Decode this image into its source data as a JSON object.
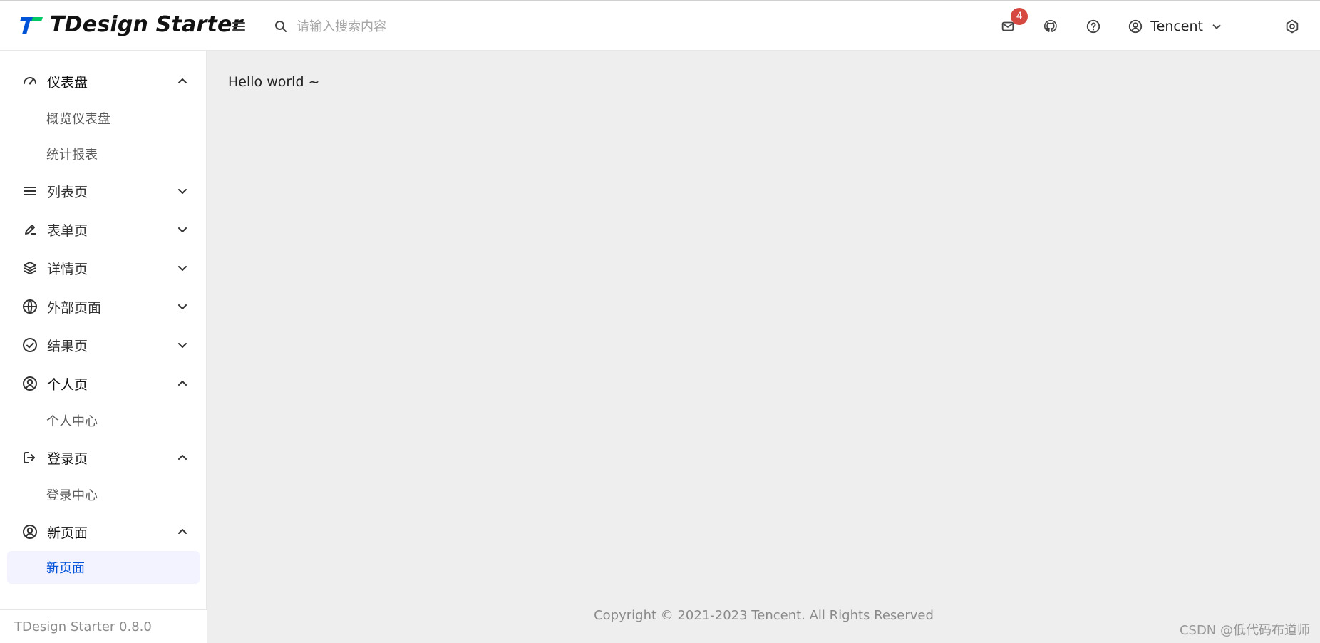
{
  "header": {
    "brand_name": "TDesign Starter",
    "search_placeholder": "请输入搜索内容",
    "notifications_badge": "4",
    "user_label": "Tencent",
    "colors": {
      "logo_blue": "#0052d9",
      "logo_green": "#00c865",
      "badge": "#d54941"
    },
    "icons": {
      "menu": "menu-icon",
      "search": "search-icon",
      "mail": "mail-icon",
      "github": "github-icon",
      "help": "help-icon",
      "user": "user-circle-icon",
      "chevron": "chevron-down-icon",
      "settings": "settings-icon"
    }
  },
  "sidebar": {
    "groups": [
      {
        "label": "仪表盘",
        "icon": "dashboard-icon",
        "expanded": true,
        "children": [
          {
            "label": "概览仪表盘"
          },
          {
            "label": "统计报表"
          }
        ]
      },
      {
        "label": "列表页",
        "icon": "list-icon",
        "expanded": false
      },
      {
        "label": "表单页",
        "icon": "edit-icon",
        "expanded": false
      },
      {
        "label": "详情页",
        "icon": "layers-icon",
        "expanded": false
      },
      {
        "label": "外部页面",
        "icon": "globe-icon",
        "expanded": false
      },
      {
        "label": "结果页",
        "icon": "check-circle-icon",
        "expanded": false
      },
      {
        "label": "个人页",
        "icon": "user-circle-icon",
        "expanded": true,
        "children": [
          {
            "label": "个人中心"
          }
        ]
      },
      {
        "label": "登录页",
        "icon": "logout-icon",
        "expanded": true,
        "children": [
          {
            "label": "登录中心"
          }
        ]
      },
      {
        "label": "新页面",
        "icon": "user-circle-icon",
        "expanded": true,
        "children": [
          {
            "label": "新页面",
            "active": true
          }
        ]
      }
    ],
    "footer_text": "TDesign Starter 0.8.0",
    "active_color": "#0052d9",
    "active_bg": "#f2f3ff"
  },
  "main": {
    "content_text": "Hello world ~",
    "footer_text": "Copyright © 2021-2023 Tencent. All Rights Reserved",
    "watermark": "CSDN @低代码布道师"
  }
}
